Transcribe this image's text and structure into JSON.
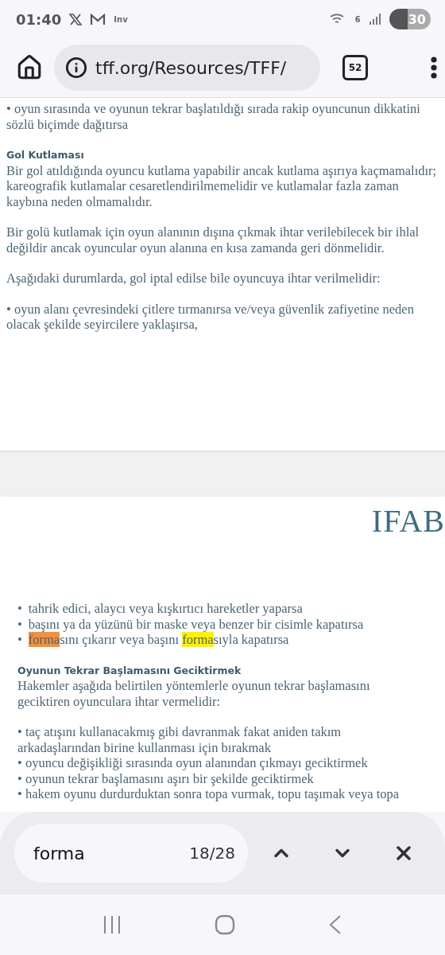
{
  "status_bar": {
    "time": "01:40",
    "notification_text": "Inv",
    "wifi_label": "6",
    "battery": "30"
  },
  "browser": {
    "url": "tff.org/Resources/TFF/",
    "tab_count": "52"
  },
  "pages": [
    {
      "groups": [
        {
          "items": [
            {
              "kind": "text",
              "text": "•  oyun sırasında ve oyunun tekrar başlatıldığı sırada rakip oyuncunun dikkatini sözlü biçimde dağıtırsa"
            }
          ]
        },
        {
          "items": [
            {
              "kind": "heading",
              "text": "Gol Kutlaması"
            },
            {
              "kind": "text",
              "text": "Bir gol atıldığında oyuncu kutlama yapabilir ancak kutlama aşırıya kaçmamalıdır; kareografik kutlamalar cesaretlendirilmemelidir ve kutlamalar fazla zaman kaybına neden olmamalıdır."
            }
          ]
        },
        {
          "items": [
            {
              "kind": "text",
              "text": "Bir golü kutlamak için oyun alanının dışına çıkmak ihtar verilebilecek bir ihlal değildir ancak oyuncular oyun alanına en kısa zamanda geri dönmelidir."
            }
          ]
        },
        {
          "items": [
            {
              "kind": "text",
              "text": "Aşağıdaki durumlarda, gol iptal edilse bile oyuncuya ihtar verilmelidir:"
            }
          ]
        },
        {
          "items": [
            {
              "kind": "text",
              "text": "•  oyun alanı çevresindeki çitlere tırmanırsa ve/veya güvenlik zafiyetine neden olacak şekilde seyircilere yaklaşırsa,"
            }
          ]
        }
      ]
    },
    {
      "logo": "IFAB",
      "groups": [
        {
          "items": [
            {
              "kind": "bullet",
              "marker": "•",
              "parts": [
                {
                  "text": "tahrik edici, alaycı veya kışkırtıcı hareketler yaparsa"
                }
              ]
            },
            {
              "kind": "bullet",
              "marker": "•",
              "parts": [
                {
                  "text": "başını ya da yüzünü bir maske veya benzer bir cisimle kapatırsa"
                }
              ]
            },
            {
              "kind": "bullet",
              "marker": "•",
              "parts": [
                {
                  "text": "forma",
                  "highlighted": true,
                  "current": true
                },
                {
                  "text": "sını çıkarır veya başını "
                },
                {
                  "text": "forma",
                  "highlighted": true,
                  "current": false
                },
                {
                  "text": "sıyla kapatırsa"
                }
              ]
            }
          ]
        },
        {
          "items": [
            {
              "kind": "heading",
              "text": "Oyunun Tekrar Başlamasını Geciktirmek"
            },
            {
              "kind": "text",
              "text": "Hakemler aşağıda belirtilen yöntemlerle oyunun tekrar başlamasını geciktiren oyunculara ihtar vermelidir:"
            }
          ]
        },
        {
          "items": [
            {
              "kind": "text",
              "text": "•  taç atışını kullanacakmış gibi davranmak fakat aniden takım arkadaşlarından birine kullanması için bırakmak"
            },
            {
              "kind": "text",
              "text": "•  oyuncu değişikliği sırasında oyun alanından çıkmayı geciktirmek"
            },
            {
              "kind": "text",
              "text": "•  oyunun tekrar başlamasını aşırı bir şekilde geciktirmek"
            },
            {
              "kind": "text",
              "text": "•  hakem oyunu durdurduktan sonra topa vurmak, topu taşımak veya topa"
            }
          ]
        }
      ]
    }
  ],
  "find_bar": {
    "query": "forma",
    "count": "18/28"
  }
}
